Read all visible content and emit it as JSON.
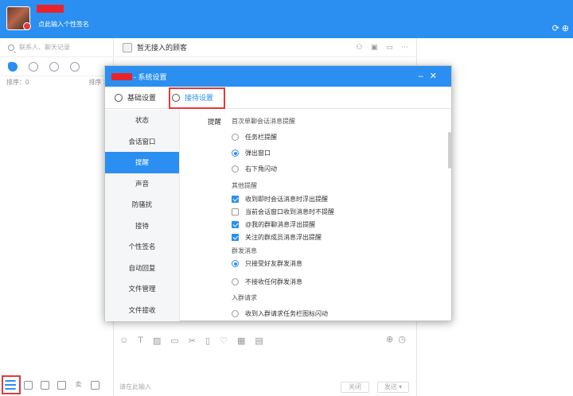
{
  "app": {
    "signature": "点此输入个性签名",
    "search_placeholder": "联系人、聊天记录",
    "sort_left": "排序：0",
    "sort_right": "排序 1",
    "chat_header": "暂无接入的顾客",
    "input_hint": "请在此输入",
    "close_label": "关闭",
    "send_label": "发送 ▾"
  },
  "dialog": {
    "title": "- 系统设置",
    "tabs": [
      {
        "label": "基础设置"
      },
      {
        "label": "接待设置"
      }
    ],
    "nav": [
      {
        "label": "状态"
      },
      {
        "label": "会话窗口"
      },
      {
        "label": "提醒"
      },
      {
        "label": "声音"
      },
      {
        "label": "防骚扰"
      },
      {
        "label": "接待"
      },
      {
        "label": "个性签名"
      },
      {
        "label": "自动回复"
      },
      {
        "label": "文件管理"
      },
      {
        "label": "文件接收"
      }
    ],
    "section_label": "提醒",
    "groups": {
      "first_msg_title": "首次单聊会话消息提醒",
      "first_msg_options": [
        "任务栏提醒",
        "弹出窗口",
        "右下角闪动"
      ],
      "other_title": "其他提醒",
      "other_options": [
        "收到即时会话消息时浮出提醒",
        "当前会话窗口收到消息时不提醒",
        "@我的群聊消息浮出提醒",
        "关注的群成员消息浮出提醒"
      ],
      "group_msg_title": "群发消息",
      "group_msg_options": [
        "只接受好友群发消息",
        "不接收任何群发消息"
      ],
      "join_title": "入群请求",
      "join_options": [
        "收到入群请求任务栏图标闪动"
      ]
    }
  },
  "colors": {
    "accent": "#2a8ff0",
    "highlight": "#e53935"
  }
}
